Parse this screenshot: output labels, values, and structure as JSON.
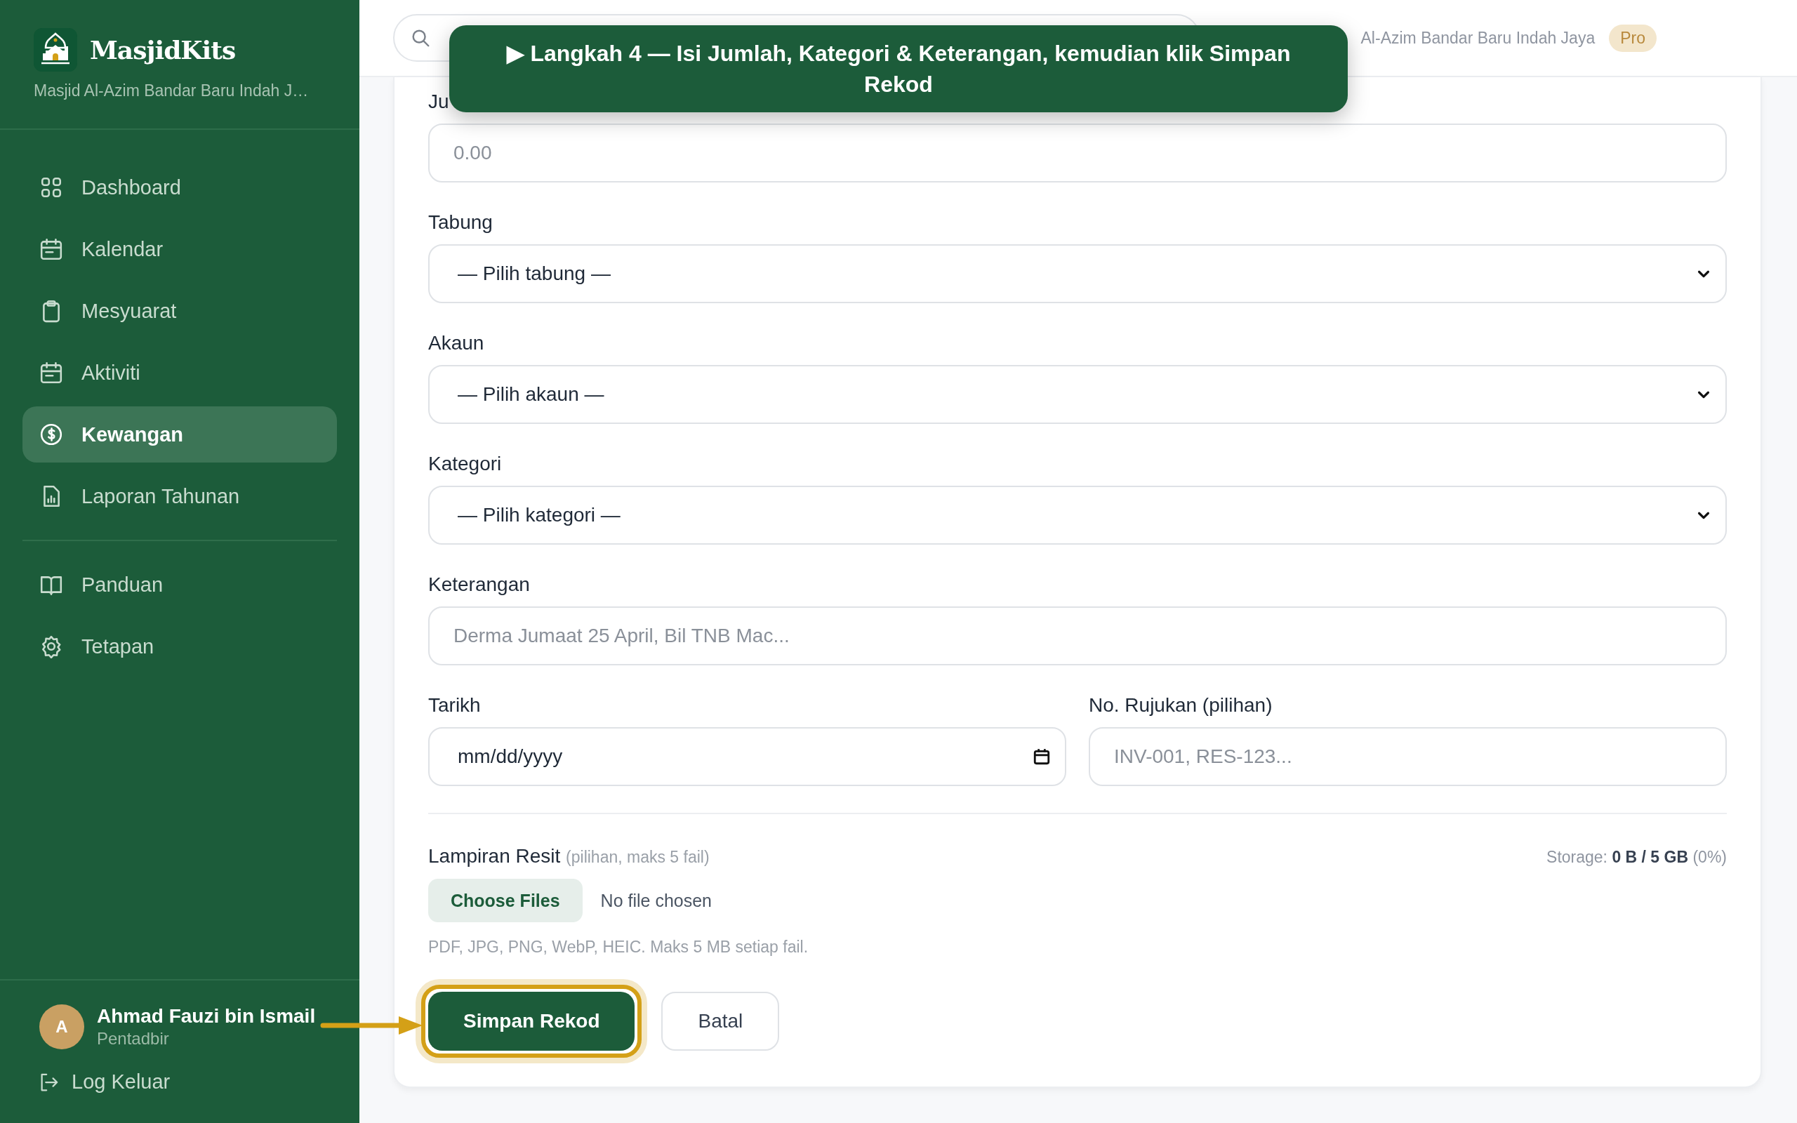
{
  "sidebar": {
    "logo_title": "MasjidKits",
    "subtitle": "Masjid Al-Azim Bandar Baru Indah J…",
    "nav": [
      {
        "label": "Dashboard",
        "kind": "grid",
        "selected": false
      },
      {
        "label": "Kalendar",
        "kind": "calendar",
        "selected": false
      },
      {
        "label": "Mesyuarat",
        "kind": "clipboard",
        "selected": false
      },
      {
        "label": "Aktiviti",
        "kind": "calendar",
        "selected": false
      },
      {
        "label": "Kewangan",
        "kind": "dollar",
        "selected": true
      },
      {
        "label": "Laporan Tahunan",
        "kind": "report",
        "selected": false
      }
    ],
    "footer_nav": [
      {
        "label": "Panduan",
        "kind": "book",
        "selected": false
      },
      {
        "label": "Tetapan",
        "kind": "gear",
        "selected": false
      }
    ],
    "user": {
      "initial": "A",
      "name": "Ahmad Fauzi bin Ismail",
      "role": "Pentadbir"
    },
    "logout": "Log Keluar"
  },
  "topbar": {
    "masjid_name": "Al-Azim Bandar Baru Indah Jaya",
    "plan_badge": "Pro"
  },
  "tooltip": {
    "text": "▶ Langkah 4 — Isi Jumlah, Kategori & Keterangan, kemudian klik Simpan Rekod"
  },
  "form": {
    "fields": [
      {
        "label": "Ju",
        "kind": "input",
        "placeholder": "0.00"
      },
      {
        "label": "Tabung",
        "kind": "select",
        "value": "— Pilih tabung —"
      },
      {
        "label": "Akaun",
        "kind": "select",
        "value": "— Pilih akaun —"
      },
      {
        "label": "Kategori",
        "kind": "select",
        "value": "— Pilih kategori —"
      },
      {
        "label": "Keterangan",
        "kind": "input",
        "placeholder": "Derma Jumaat 25 April, Bil TNB Mac..."
      }
    ],
    "date_row": [
      {
        "label": "Tarikh",
        "kind": "date",
        "value": "mm/dd/yyyy"
      },
      {
        "label": "No. Rujukan (pilihan)",
        "kind": "input",
        "placeholder": "INV-001, RES-123..."
      }
    ],
    "attachment": {
      "label": "Lampiran Resit",
      "hint": "(pilihan, maks 5 fail)",
      "storage": "Storage: **0 B / 5 GB** (0%)",
      "choose_button": "Choose Files",
      "file_status": "No file chosen",
      "formats": "PDF, JPG, PNG, WebP, HEIC. Maks 5 MB setiap fail."
    },
    "buttons": [
      {
        "label": "Simpan Rekod",
        "kind": "primary",
        "highlighted": true
      },
      {
        "label": "Batal",
        "kind": "secondary",
        "highlighted": false
      }
    ]
  }
}
